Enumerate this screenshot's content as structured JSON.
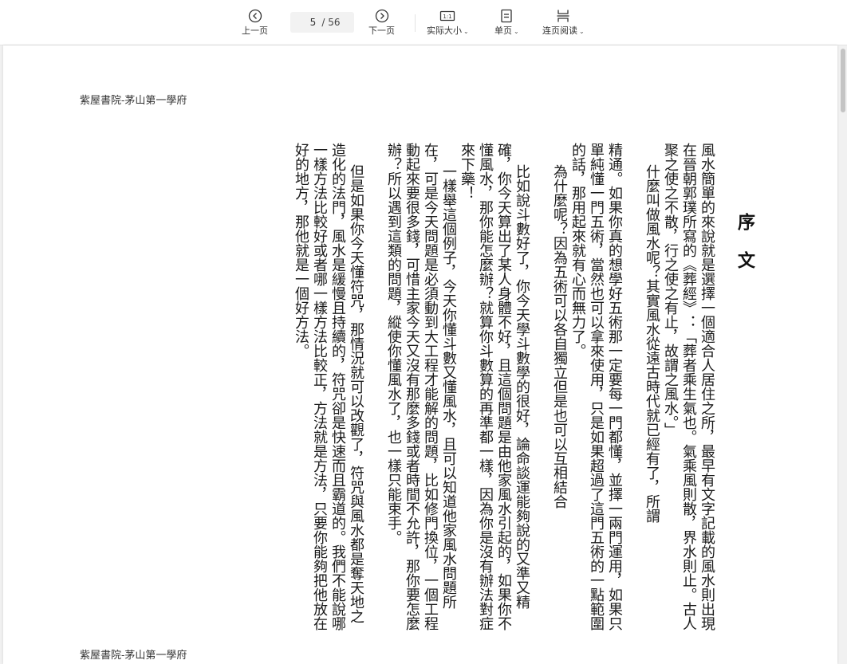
{
  "toolbar": {
    "prev_label": "上一页",
    "next_label": "下一页",
    "current_page": "5",
    "total_pages": "/ 56",
    "actual_size_label": "实际大小",
    "single_page_label": "单页",
    "continuous_label": "连页阅读",
    "icons": {
      "prev": "chevron-left-circle-icon",
      "next": "chevron-right-circle-icon",
      "actual_size": "one-to-one-icon",
      "single_page": "single-page-icon",
      "continuous": "continuous-page-icon"
    }
  },
  "document": {
    "header": "紫屋書院-茅山第一學府",
    "footer": "紫屋書院-茅山第一學府",
    "title": "序文",
    "paragraphs": [
      "風水簡單的來說就是選擇一個適合人居住之所，最早有文字記載的風水則出現在晉朝郭璞所寫的《葬經》：「葬者乘生氣也。氣乘風則散，界水則止。古人聚之使之不散，行之使之有止，故謂之風水。」",
      "什麼叫做風水呢？其實風水從遠古時代就已經有了，所謂",
      "精通。如果你真的想學好五術那一定要每一門都懂，並擇一兩門運用，如果只單純懂一門五術，當然也可以拿來使用，只是如果超過了這門五術的一點範圍的話，那用起來就有心而無力了。",
      "為什麼呢？因為五術可以各自獨立但是也可以互相結合",
      "比如說斗數好了，你今天學斗數學的很好，論命談運能夠說的又準又精確，你今天算出了某人身體不好，且這個問題是由他家風水引起的，如果你不懂風水，那你能怎麼辦？就算你斗數算的再準都一樣，因為你是沒有辦法對症來下藥！",
      "一樣舉這個例子，今天你懂斗數又懂風水，且可以知道他家風水問題所在，可是今天問題是必須動到大工程才能解的問題，比如修門換位，一個工程動起來要很多錢，可惜主家今天又沒有那麼多錢或者時間不允許，那你要怎麼辦？所以遇到這類的問題，縱使你懂風水了，也一樣只能束手。",
      "但是如果你今天懂符咒，那情況就可以改觀了，符咒與風水都是奪天地之造化的法門，風水是緩慢且持續的，符咒卻是快速而且霸道的。我們不能說哪一樣方法比較好或者哪一樣方法比較正，方法就是方法，只要你能夠把他放在好的地方，那他就是一個好方法。"
    ]
  },
  "colors": {
    "toolbar_bg": "#ffffff",
    "page_bg": "#ffffff",
    "viewer_bg": "#f1f1f1",
    "text": "#1a1a1a"
  }
}
